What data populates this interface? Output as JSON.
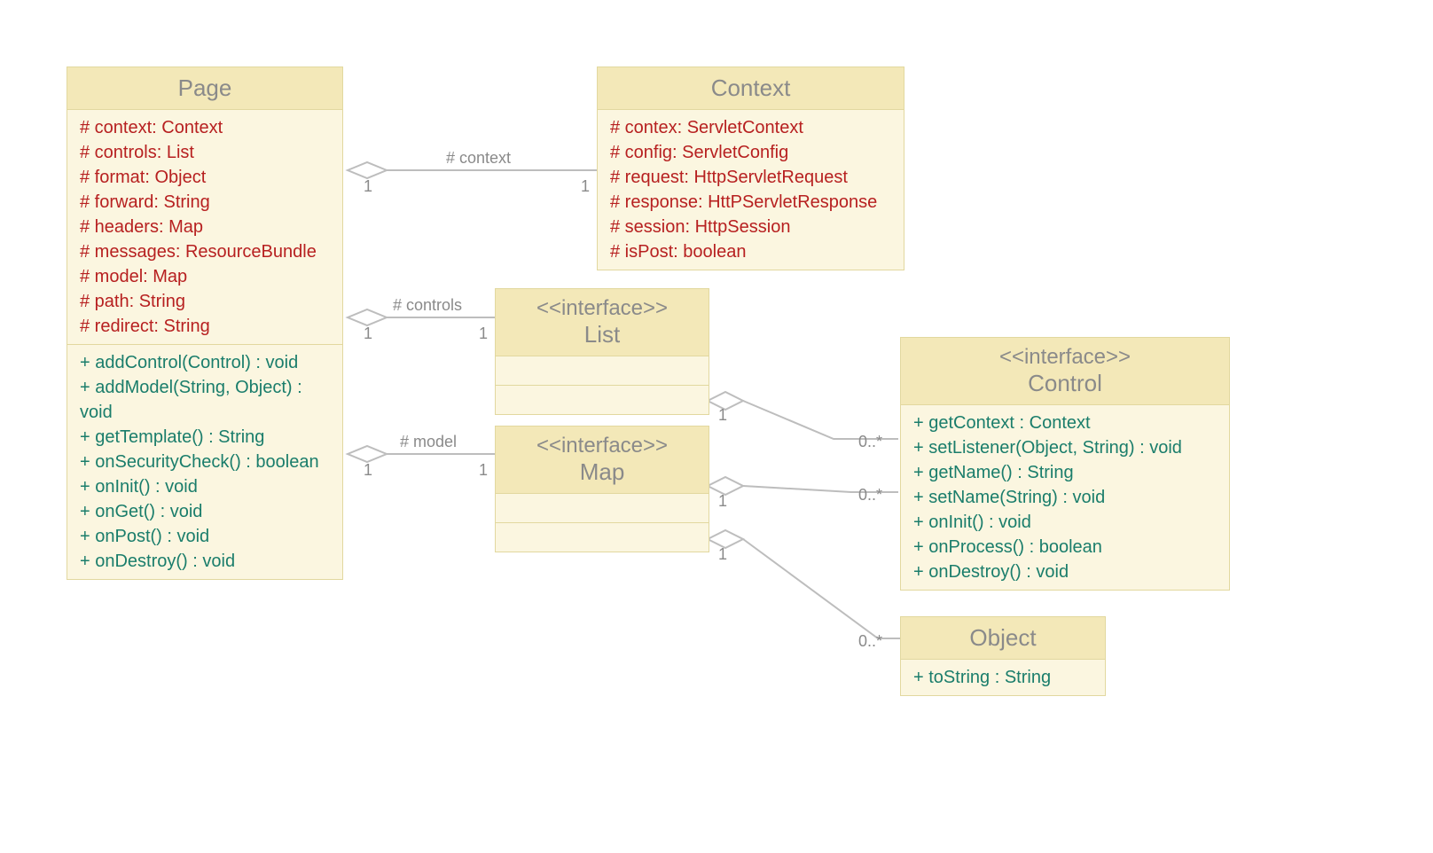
{
  "page": {
    "title": "Page",
    "attrs": [
      "# context: Context",
      "# controls: List",
      "# format: Object",
      "# forward: String",
      "# headers: Map",
      "# messages: ResourceBundle",
      "# model: Map",
      "# path: String",
      "# redirect: String"
    ],
    "ops": [
      "+ addControl(Control) : void",
      "+ addModel(String, Object) : void",
      "+ getTemplate() : String",
      "+ onSecurityCheck() : boolean",
      "+ onInit() : void",
      "+ onGet() : void",
      "+ onPost() : void",
      "+ onDestroy() : void"
    ]
  },
  "context": {
    "title": "Context",
    "attrs": [
      "# contex: ServletContext",
      "# config: ServletConfig",
      "# request: HttpServletRequest",
      "# response: HttPServletResponse",
      "# session: HttpSession",
      "# isPost: boolean"
    ]
  },
  "list": {
    "stereo": "<<interface>>",
    "title": "List"
  },
  "map": {
    "stereo": "<<interface>>",
    "title": "Map"
  },
  "control": {
    "stereo": "<<interface>>",
    "title": "Control",
    "ops": [
      "+ getContext : Context",
      "+ setListener(Object, String) : void",
      "+ getName() : String",
      "+ setName(String) : void",
      "+ onInit() : void",
      "+ onProcess() : boolean",
      "+ onDestroy() : void"
    ]
  },
  "object": {
    "title": "Object",
    "ops": [
      "+ toString : String"
    ]
  },
  "labels": {
    "contextRole": "# context",
    "controlsRole": "# controls",
    "modelRole": "# model",
    "one": "1",
    "zeroMany": "0..*"
  }
}
